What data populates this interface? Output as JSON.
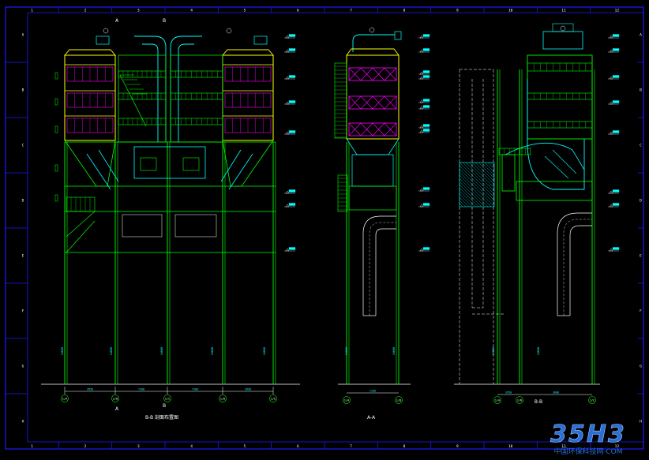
{
  "border": {
    "columns": [
      "1",
      "2",
      "3",
      "4",
      "5",
      "6",
      "7",
      "8",
      "9",
      "10",
      "11",
      "12"
    ],
    "rows": [
      "A",
      "B",
      "C",
      "D",
      "E",
      "F",
      "G",
      "H"
    ]
  },
  "views": {
    "front_caption": "B-B 剖面布置图",
    "side_caption": "A-A",
    "right_caption": "B-B"
  },
  "section_marks": {
    "top_left": "A",
    "top_right": "B",
    "bottom_left": "A",
    "bottom_right": "B"
  },
  "axis_bubbles": {
    "front": [
      "1/A",
      "1/B",
      "1/C",
      "1/D",
      "1/E"
    ],
    "side": [
      "1/A",
      "1/B"
    ],
    "right": [
      "1/A",
      "1/B",
      "1/C"
    ]
  },
  "dimensions": {
    "front": [
      "3950",
      "7200",
      "7200",
      "3950"
    ],
    "side": [
      "7200"
    ],
    "right": [
      "3950",
      "3600"
    ]
  },
  "watermark": {
    "logo": "35H3",
    "subtitle": "中国环保科技网·COM"
  },
  "colors": {
    "frame": "#1a1aff",
    "structure": "#00ff00",
    "duct": "#00ffff",
    "hopper": "#ffff00",
    "filter": "#ff00ff",
    "hatch": "#00ffff",
    "label": "#00ffff",
    "text_white": "#ffffff",
    "watermark": "#2a6fd6"
  }
}
